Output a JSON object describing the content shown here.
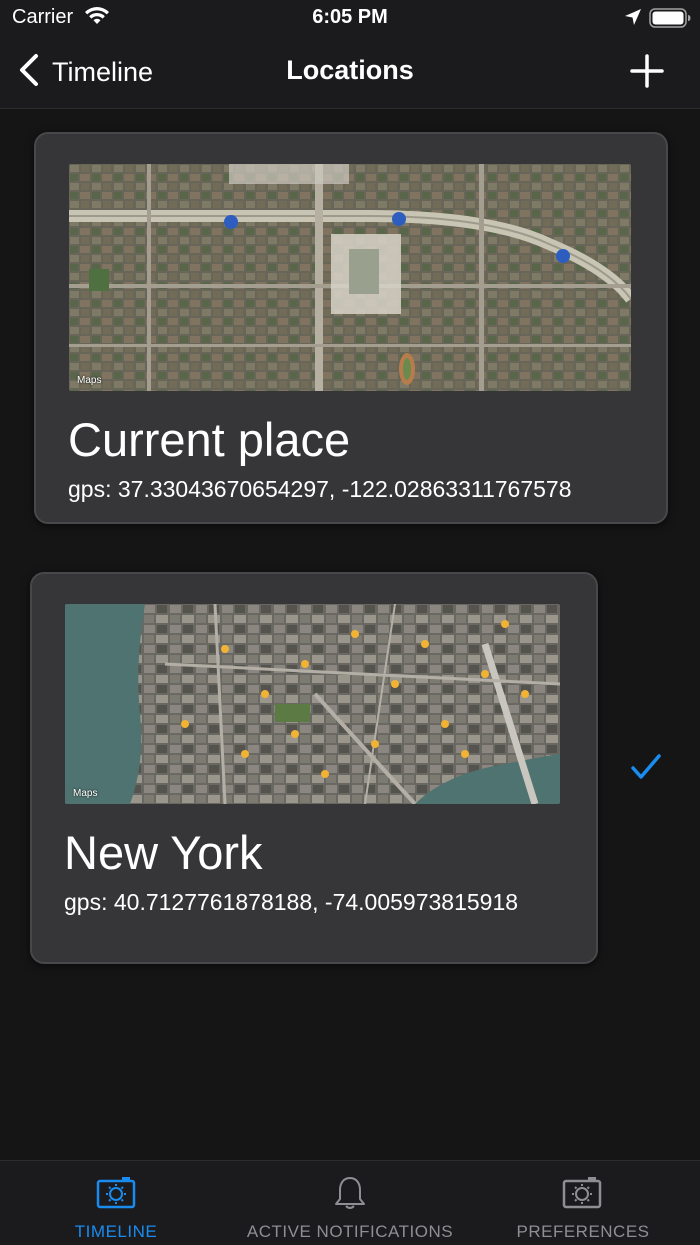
{
  "status_bar": {
    "carrier": "Carrier",
    "time": "6:05 PM"
  },
  "nav": {
    "back_label": "Timeline",
    "title": "Locations",
    "add_icon": "plus-icon",
    "back_icon": "chevron-left-icon"
  },
  "locations": [
    {
      "title": "Current place",
      "gps": "gps: 37.33043670654297, -122.02863311767578",
      "map_attribution": "Maps",
      "selected": false
    },
    {
      "title": "New York",
      "gps": "gps: 40.7127761878188, -74.005973815918",
      "map_attribution": "Maps",
      "selected": true
    }
  ],
  "tabs": [
    {
      "label": "TIMELINE",
      "icon": "camera-sun-icon",
      "active": true
    },
    {
      "label": "ACTIVE NOTIFICATIONS",
      "icon": "bell-icon",
      "active": false
    },
    {
      "label": "PREFERENCES",
      "icon": "camera-gear-icon",
      "active": false
    }
  ],
  "colors": {
    "accent": "#1a8cf0",
    "background": "#151516",
    "card": "#363638",
    "inactive_tab": "#8e8e93"
  }
}
